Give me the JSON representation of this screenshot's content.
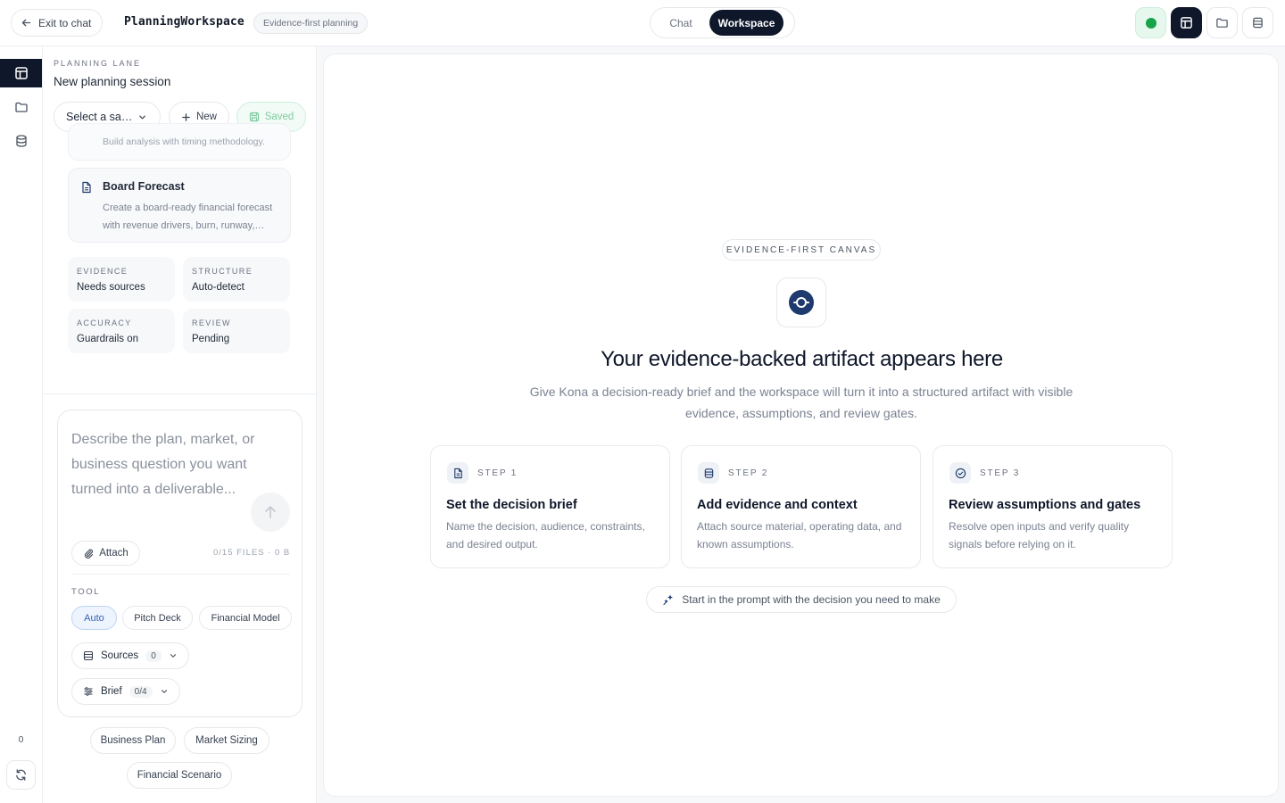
{
  "topbar": {
    "exit_label": "Exit to chat",
    "app_title": "PlanningWorkspace",
    "subtitle_chip": "Evidence-first planning",
    "modes": {
      "chat": "Chat",
      "workspace": "Workspace",
      "active": "Workspace"
    },
    "status_color": "#16a34a",
    "icons": [
      "layout-icon",
      "folder-icon",
      "database-icon"
    ]
  },
  "rail": {
    "items": [
      "layout-icon",
      "folder-icon",
      "database-icon"
    ],
    "active_item": "layout-icon",
    "count": "0",
    "refresh_icon": "refresh-icon"
  },
  "panel": {
    "lane_label": "PLANNING LANE",
    "session_name": "New planning session",
    "select_label": "Select a sa…",
    "new_label": "New",
    "saved_label": "Saved",
    "clipped_card_text": "Build analysis with timing methodology.",
    "template": {
      "title": "Board Forecast",
      "description": "Create a board-ready financial forecast with revenue drivers, burn, runway,…"
    },
    "stats": [
      {
        "key": "EVIDENCE",
        "value": "Needs sources"
      },
      {
        "key": "STRUCTURE",
        "value": "Auto-detect"
      },
      {
        "key": "ACCURACY",
        "value": "Guardrails on"
      },
      {
        "key": "REVIEW",
        "value": "Pending"
      }
    ]
  },
  "composer": {
    "placeholder": "Describe the plan, market, or business question you want turned into a deliverable...",
    "attach_label": "Attach",
    "files_info": "0/15 FILES · 0 B",
    "tool_label": "TOOL",
    "tools": [
      "Auto",
      "Pitch Deck",
      "Financial Model"
    ],
    "active_tool": "Auto",
    "sources_label": "Sources",
    "sources_count": "0",
    "brief_label": "Brief",
    "brief_count": "0/4"
  },
  "suggestions": [
    "Business Plan",
    "Market Sizing",
    "Financial Scenario"
  ],
  "canvas": {
    "badge": "EVIDENCE-FIRST CANVAS",
    "title": "Your evidence-backed artifact appears here",
    "description": "Give Kona a decision-ready brief and the workspace will turn it into a structured artifact with visible evidence, assumptions, and review gates.",
    "steps": [
      {
        "label": "STEP 1",
        "title": "Set the decision brief",
        "description": "Name the decision, audience, constraints, and desired output.",
        "icon": "document-icon"
      },
      {
        "label": "STEP 2",
        "title": "Add evidence and context",
        "description": "Attach source material, operating data, and known assumptions.",
        "icon": "database-icon"
      },
      {
        "label": "STEP 3",
        "title": "Review assumptions and gates",
        "description": "Resolve open inputs and verify quality signals before relying on it.",
        "icon": "check-circle-icon"
      }
    ],
    "hint": "Start in the prompt with the decision you need to make",
    "accent_color": "#1e3a6e"
  }
}
